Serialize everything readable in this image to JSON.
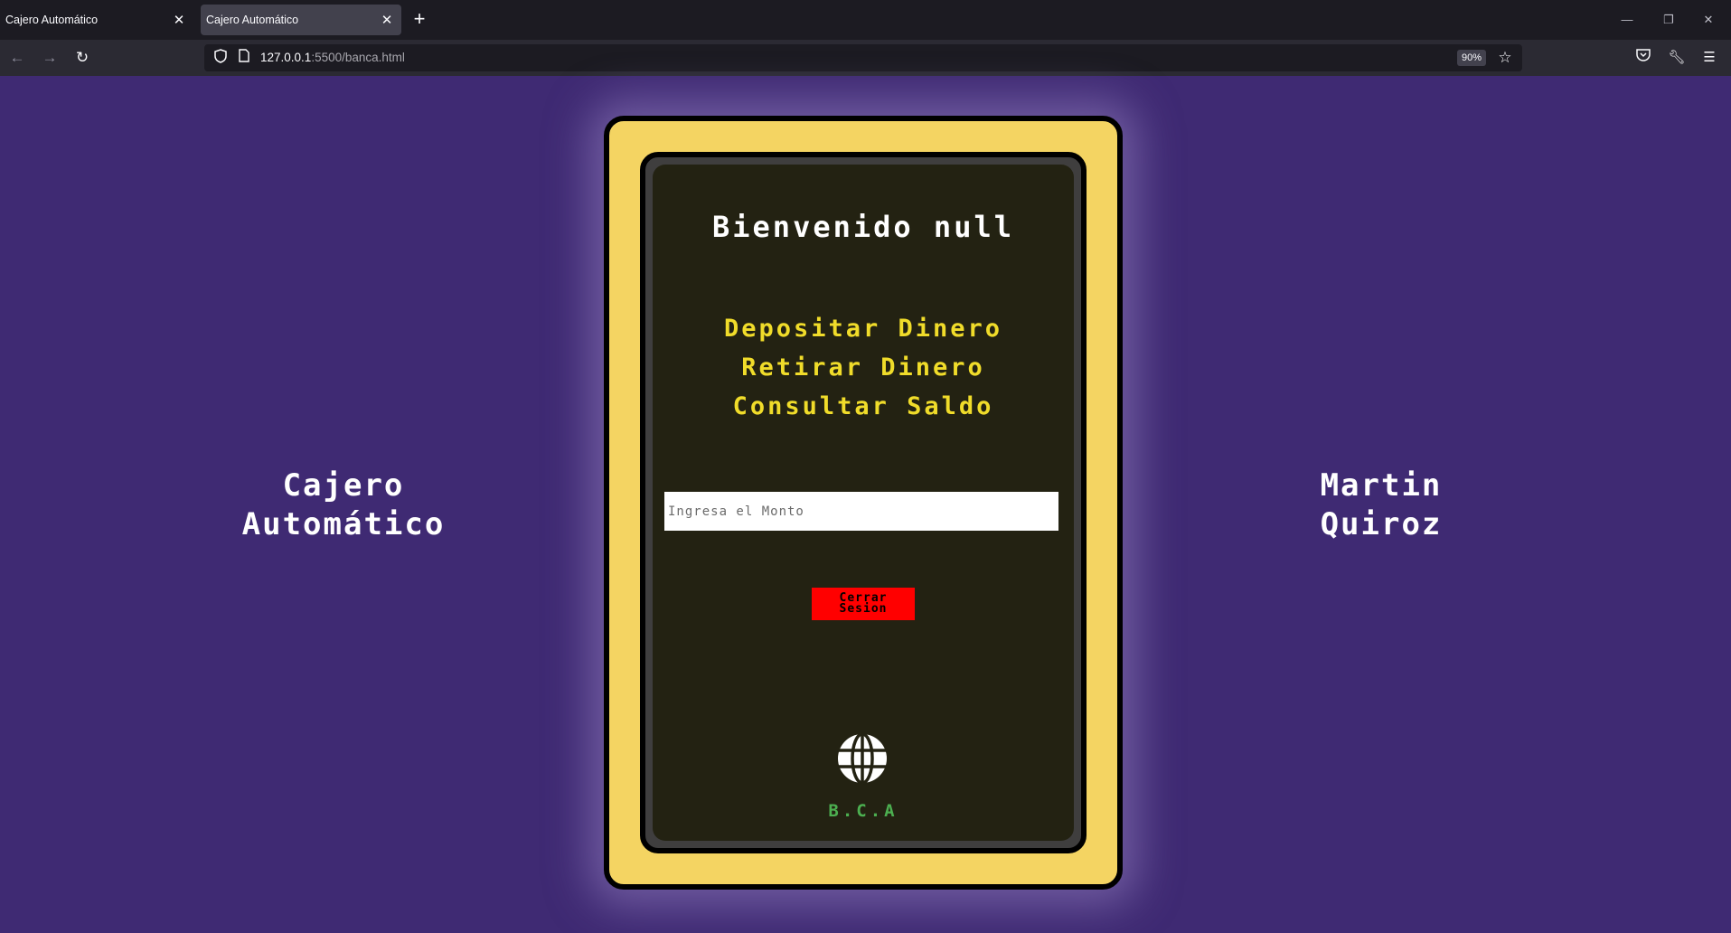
{
  "browser": {
    "tabs": [
      {
        "title": "Cajero Automático",
        "active": false
      },
      {
        "title": "Cajero Automático",
        "active": true
      }
    ],
    "url_host": "127.0.0.1",
    "url_path": ":5500/banca.html",
    "zoom": "90%"
  },
  "page": {
    "left_title_line1": "Cajero",
    "left_title_line2": "Automático",
    "right_title_line1": "Martin",
    "right_title_line2": "Quiroz",
    "atm": {
      "welcome": "Bienvenido null",
      "menu": [
        "Depositar Dinero",
        "Retirar Dinero",
        "Consultar Saldo"
      ],
      "amount_placeholder": "Ingresa el Monto",
      "amount_value": "",
      "logout_label": "Cerrar\nSesion",
      "bank_name": "B.C.A"
    }
  },
  "colors": {
    "page_bg": "#3f2a73",
    "atm_body": "#f4d462",
    "screen_bg": "#232212",
    "menu_text": "#f0dc2a",
    "logout_bg": "#ff0000",
    "bank_name": "#4caf50"
  },
  "icons": {
    "back": "arrow-left-icon",
    "forward": "arrow-right-icon",
    "reload": "reload-icon",
    "shield": "shield-icon",
    "page": "page-icon",
    "bookmark": "star-icon",
    "pocket": "pocket-icon",
    "tools": "wrench-icon",
    "menu": "hamburger-menu-icon",
    "bank_logo": "globe-icon"
  }
}
